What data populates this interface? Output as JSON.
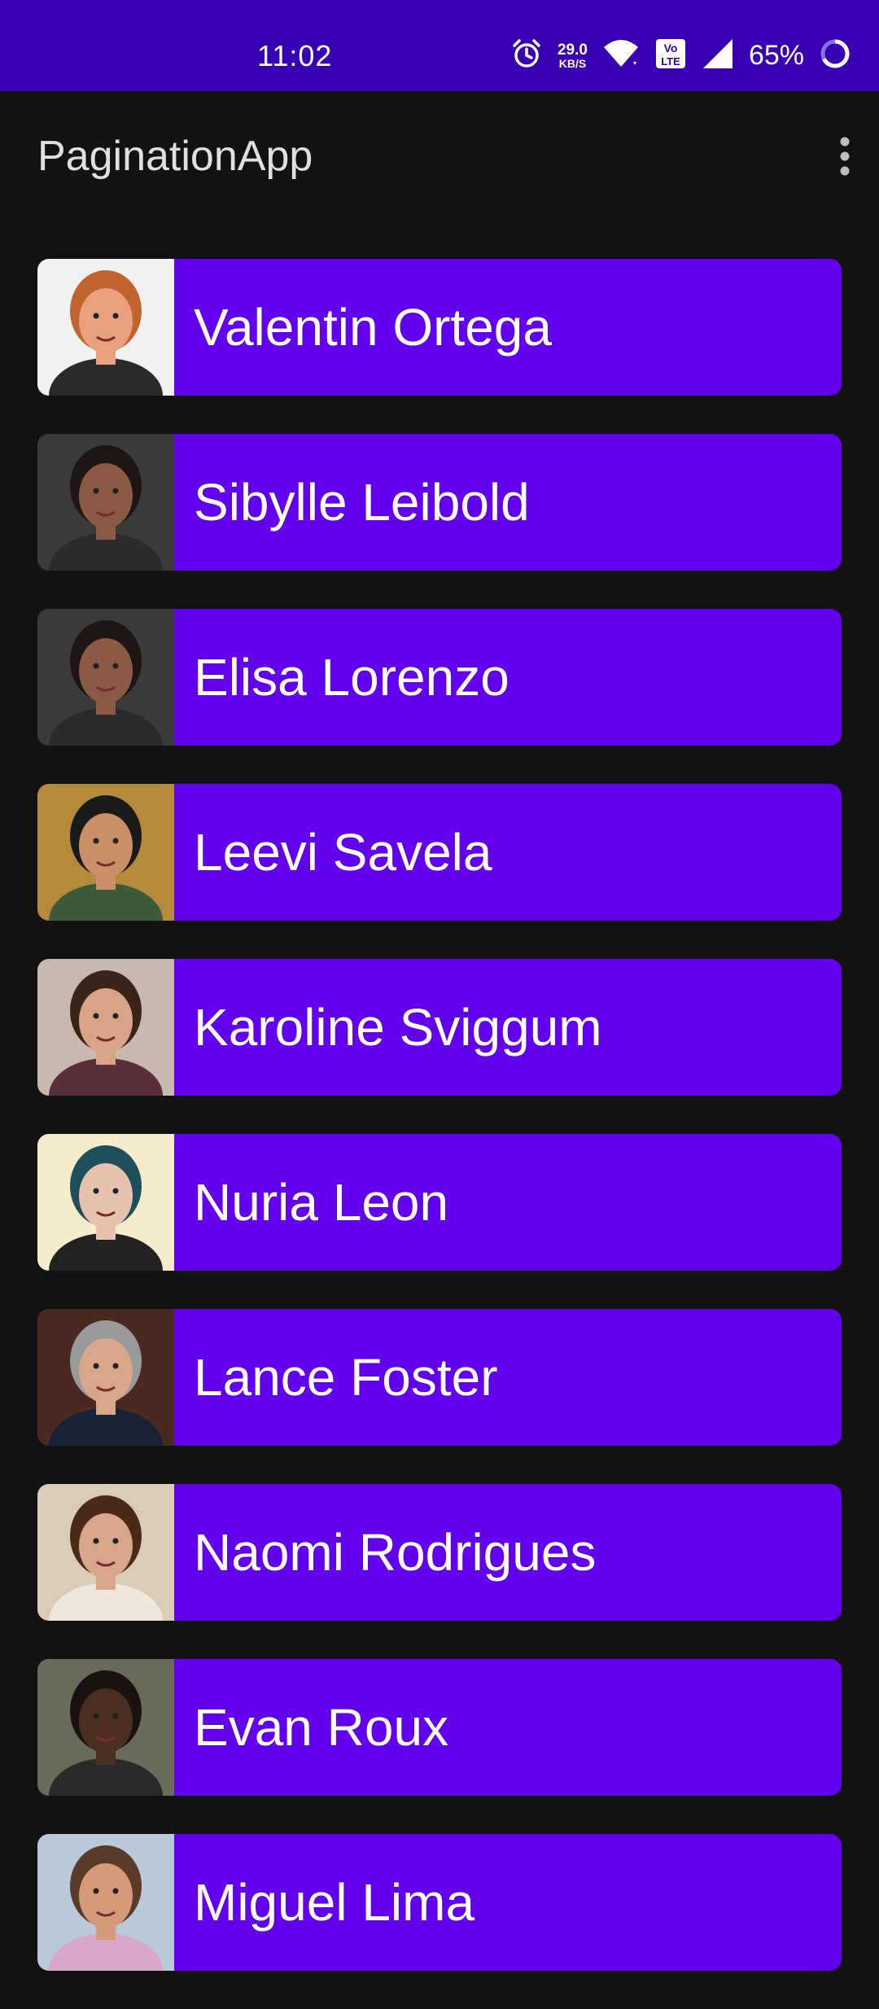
{
  "status_bar": {
    "time": "11:02",
    "net_speed_value": "29.0",
    "net_speed_unit": "KB/S",
    "volte": "Vo LTE",
    "battery": "65%",
    "icons": [
      "alarm-icon",
      "wifi-icon",
      "volte-icon",
      "signal-icon",
      "battery-icon"
    ]
  },
  "app_bar": {
    "title": "PaginationApp",
    "overflow_icon": "more-vert-icon"
  },
  "colors": {
    "status_bar": "#3700B3",
    "background": "#121212",
    "card": "#6200EE",
    "text": "#FFFFFF"
  },
  "users": [
    {
      "name": "Valentin Ortega",
      "avatar": "avatar-photo",
      "skin": "#e9a07f",
      "hair": "#c0642f",
      "bg": "#f1f1f1",
      "shirt": "#2a2a2a"
    },
    {
      "name": "Sibylle Leibold",
      "avatar": "avatar-photo",
      "skin": "#8a5a44",
      "hair": "#1e1614",
      "bg": "#3a3a3a",
      "shirt": "#2b2b2b"
    },
    {
      "name": "Elisa Lorenzo",
      "avatar": "avatar-photo",
      "skin": "#8a5a44",
      "hair": "#1e1614",
      "bg": "#3a3a3a",
      "shirt": "#2b2b2b"
    },
    {
      "name": "Leevi Savela",
      "avatar": "avatar-photo",
      "skin": "#c99068",
      "hair": "#1a1a1a",
      "bg": "#b58a3a",
      "shirt": "#3d5a3a"
    },
    {
      "name": "Karoline Sviggum",
      "avatar": "avatar-photo",
      "skin": "#d9a387",
      "hair": "#3a2418",
      "bg": "#c8b9b0",
      "shirt": "#5a2f3a"
    },
    {
      "name": "Nuria Leon",
      "avatar": "avatar-photo",
      "skin": "#e8c2b0",
      "hair": "#1f4f5a",
      "bg": "#f5eccc",
      "shirt": "#222222"
    },
    {
      "name": "Lance Foster",
      "avatar": "avatar-photo",
      "skin": "#d8a78a",
      "hair": "#9a9a9a",
      "bg": "#4a2a20",
      "shirt": "#1a2236"
    },
    {
      "name": "Naomi Rodrigues",
      "avatar": "avatar-photo",
      "skin": "#d8a78a",
      "hair": "#4a2a18",
      "bg": "#d9cdb8",
      "shirt": "#efe7de"
    },
    {
      "name": "Evan Roux",
      "avatar": "avatar-photo",
      "skin": "#4a2e22",
      "hair": "#1a1210",
      "bg": "#6a6a5a",
      "shirt": "#2a2a2a"
    },
    {
      "name": "Miguel Lima",
      "avatar": "avatar-photo",
      "skin": "#d49a7a",
      "hair": "#5a3a28",
      "bg": "#b9c9d9",
      "shirt": "#d9a8c8"
    }
  ]
}
